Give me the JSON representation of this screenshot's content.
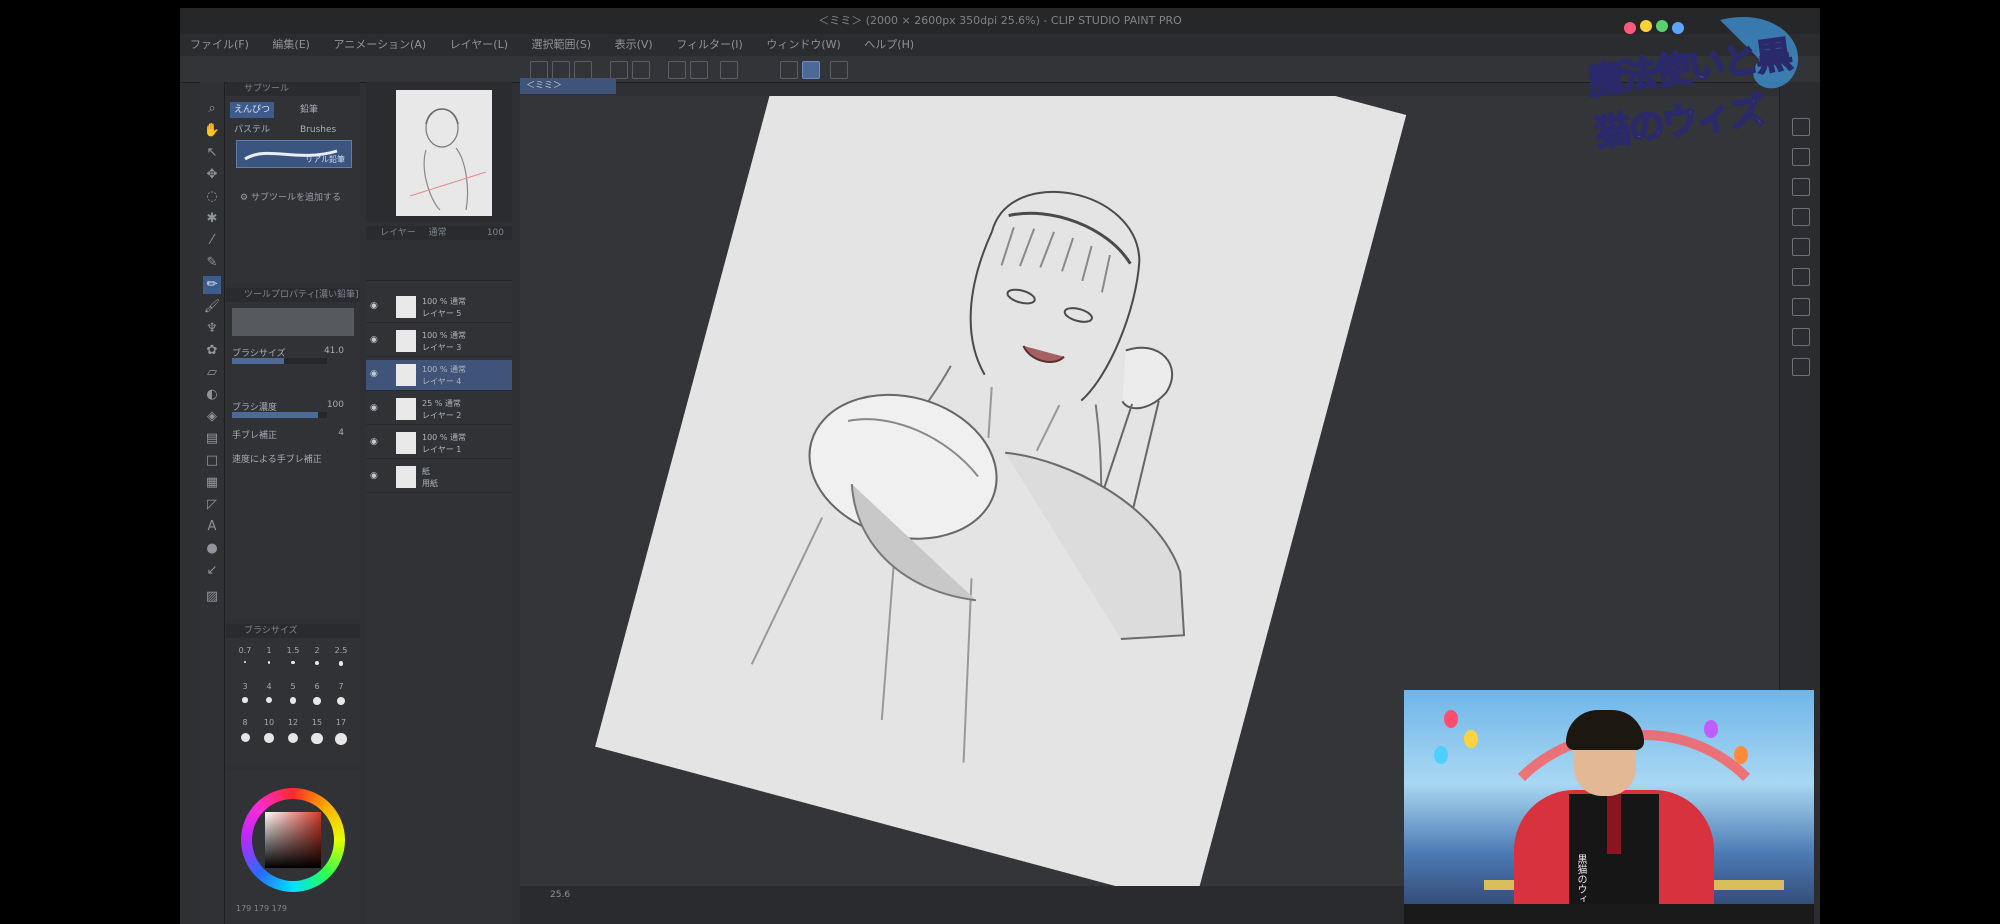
{
  "window": {
    "title": "＜ミミ＞ (2000 × 2600px 350dpi 25.6%) - CLIP STUDIO PAINT PRO"
  },
  "menu": [
    "ファイル(F)",
    "編集(E)",
    "アニメーション(A)",
    "レイヤー(L)",
    "選択範囲(S)",
    "表示(V)",
    "フィルター(I)",
    "ウィンドウ(W)",
    "ヘルプ(H)"
  ],
  "document_tab": "＜ミミ＞",
  "subtool": {
    "header": "サブツール",
    "tabs": [
      "えんぴつ",
      "鉛筆",
      "パステル",
      "Brushes"
    ],
    "selected_brush": "リアル鉛筆",
    "add_subtool": "サブツールを追加する"
  },
  "tool_property": {
    "header": "ツールプロパティ[濃い鉛筆]",
    "brush_size_label": "ブラシサイズ",
    "brush_size_value": "41.0",
    "opacity_label": "ブラシ濃度",
    "opacity_value": "100",
    "stabilization_label": "手ブレ補正",
    "stabilization_value": "4",
    "speed_label": "速度による手ブレ補正",
    "brush_size_fill_pct": 55,
    "opacity_fill_pct": 90
  },
  "brush_size_panel": {
    "header": "ブラシサイズ",
    "sizes": [
      "0.7",
      "1",
      "1.5",
      "2",
      "2.5",
      "3",
      "4",
      "5",
      "6",
      "7",
      "8",
      "10",
      "12",
      "15",
      "17"
    ]
  },
  "color": {
    "rgb": [
      "179",
      "179",
      "179"
    ],
    "accent": "#3e5c8b"
  },
  "layers": {
    "header": "レイヤー",
    "blend_mode": "通常",
    "opacity": "100",
    "items": [
      {
        "mode": "100 % 通常",
        "name": "レイヤー 5",
        "selected": false
      },
      {
        "mode": "100 % 通常",
        "name": "レイヤー 3",
        "selected": false
      },
      {
        "mode": "100 % 通常",
        "name": "レイヤー 4",
        "selected": true
      },
      {
        "mode": "25 % 通常",
        "name": "レイヤー 2",
        "selected": false
      },
      {
        "mode": "100 % 通常",
        "name": "レイヤー 1",
        "selected": false
      },
      {
        "mode": "紙",
        "name": "用紙",
        "selected": false
      }
    ]
  },
  "statusbar": {
    "zoom": "25.6"
  },
  "logo": {
    "text": "魔法使いと黒猫のウィズ"
  },
  "webcam": {
    "apron_text": "黒猫のウィズ"
  }
}
